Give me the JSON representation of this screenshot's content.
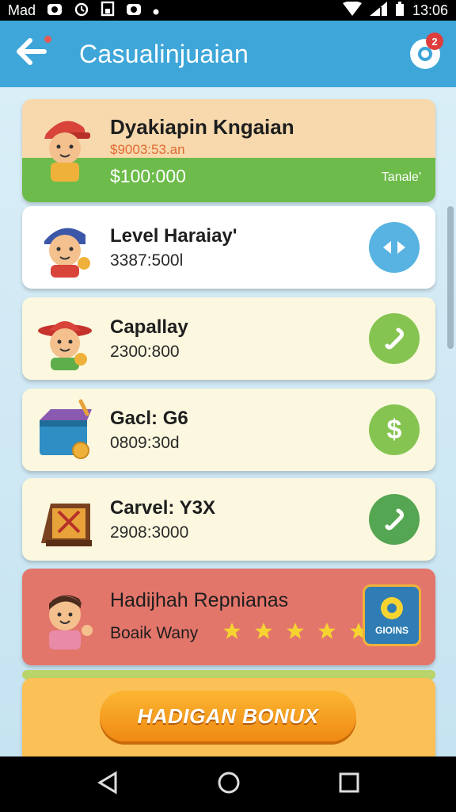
{
  "status_bar": {
    "carrier": "Mad",
    "time": "13:06"
  },
  "app_bar": {
    "title": "Casualinjuaian",
    "notification_count": "2"
  },
  "cards": [
    {
      "name": "Dyakiapin Kngaian",
      "subtitle": "$9003:53.an",
      "amount": "$100:000",
      "tag": "Tanale'"
    },
    {
      "name": "Level Haraiay'",
      "amount": "3387:500l",
      "action_icon": "arrows-icon"
    },
    {
      "name": "Capallay",
      "amount": "2300:800",
      "action_icon": "phone-icon"
    },
    {
      "name": "Gacl: G6",
      "amount": "0809:30d",
      "action_icon": "dollar-icon"
    },
    {
      "name": "Carvel: Y3X",
      "amount": "2908:3000",
      "action_icon": "link-icon"
    }
  ],
  "bonus_card": {
    "title": "Hadijhah Repnianas",
    "subtitle": "Boaik Wany",
    "stars": 5,
    "badge_label": "GIOINS"
  },
  "cta": {
    "label": "HADIGAN BONUX"
  },
  "colors": {
    "app_bar": "#3ea6d8",
    "green": "#6dbb4a",
    "red_card": "#e3766b",
    "cta_orange": "#f7a320"
  }
}
